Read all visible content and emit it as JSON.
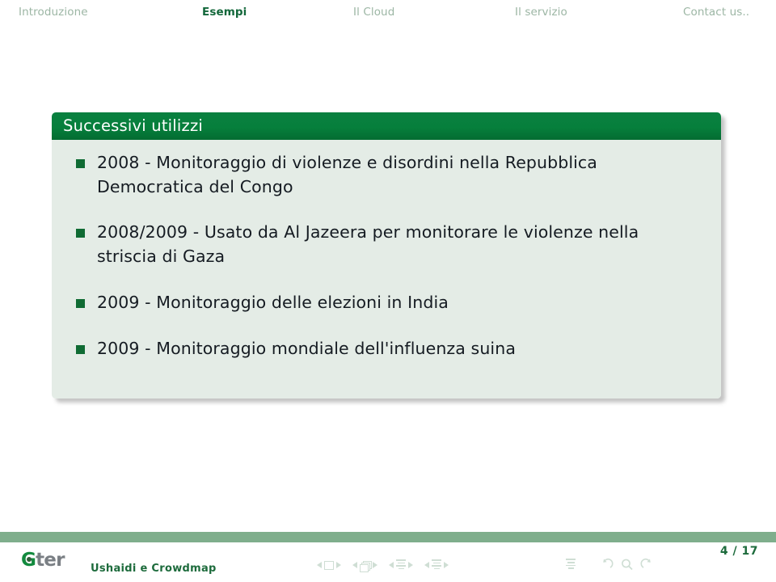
{
  "header": {
    "nav": [
      {
        "label": "Introduzione",
        "active": false
      },
      {
        "label": "Esempi",
        "active": true
      },
      {
        "label": "Il Cloud",
        "active": false
      },
      {
        "label": "Il servizio",
        "active": false
      },
      {
        "label": "Contact us..",
        "active": false
      }
    ]
  },
  "block": {
    "title": "Successivi utilizzi",
    "bullets": [
      "2008 - Monitoraggio di violenze e disordini nella Repubblica Democratica del Congo",
      "2008/2009 - Usato da Al Jazeera per monitorare le violenze nella striscia di Gaza",
      "2009 - Monitoraggio delle elezioni in India",
      "2009 - Monitoraggio mondiale dell'influenza suina"
    ]
  },
  "footer": {
    "logo_g": "G",
    "logo_rest": "ter",
    "presentation_title": "Ushaidi e Crowdmap",
    "page": "4 / 17",
    "nav_icons": [
      "prev-slide-arrow-icon",
      "slide-icon",
      "next-slide-arrow-icon",
      "prev-frame-arrow-icon",
      "frames-icon",
      "next-frame-arrow-icon",
      "prev-subsection-arrow-icon",
      "subsection-icon",
      "next-subsection-arrow-icon",
      "prev-section-arrow-icon",
      "section-icon",
      "next-section-arrow-icon",
      "document-icon",
      "back-icon",
      "search-icon",
      "forward-icon"
    ]
  },
  "colors": {
    "accent_green": "#0a8040",
    "dark_green": "#12673a",
    "inactive_nav": "#9cb6a4",
    "block_body": "#e4ece6",
    "footer_bar": "#7fae8c",
    "bullet_square": "#0f6b33",
    "body_text": "#151b22"
  }
}
